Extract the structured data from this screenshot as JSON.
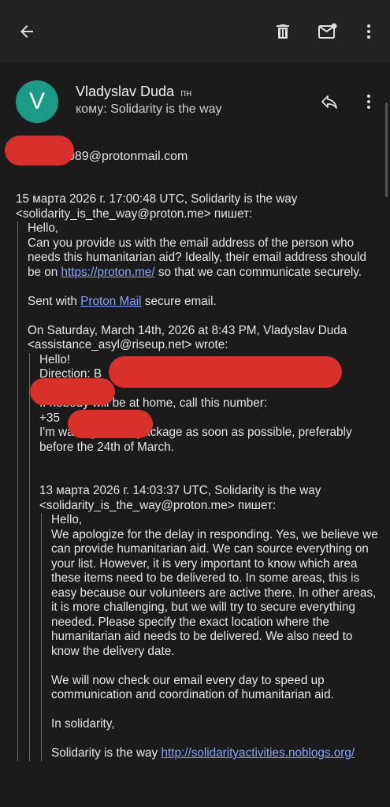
{
  "toolbar": {
    "back_icon": "arrow-back-icon",
    "delete_icon": "trash-icon",
    "mark_unread_icon": "mail-unread-icon",
    "more_icon": "more-vert-icon"
  },
  "header": {
    "avatar_letter": "V",
    "sender_name": "Vladyslav Duda",
    "day": "пн",
    "to_line": "кому: Solidarity is the way",
    "reply_icon": "reply-icon",
    "more_icon": "more-vert-icon"
  },
  "recipient_email_suffix": "089@protonmail.com",
  "message": {
    "intro_line1": "15 марта 2026 г. 17:00:48 UTC, Solidarity is the way",
    "intro_line2": "<solidarity_is_the_way@proton.me> пишет:",
    "q1": {
      "hello": "Hello,",
      "para1_a": "Can you provide us with the email address of the person who needs this humanitarian aid? Ideally, their email address should be on ",
      "para1_link": "https://proton.me/",
      "para1_b": " so that we can communicate securely.",
      "sent_a": "Sent with ",
      "sent_link": "Proton Mail",
      "sent_b": " secure email.",
      "on_line1": "On Saturday, March 14th, 2026 at 8:43 PM, Vladyslav Duda",
      "on_line2": "<assistance_asyl@riseup.net> wrote:",
      "q2": {
        "hello": "Hello!",
        "direction": "Direction: B",
        "if_nobody": "If nobody will be at home, call this number:",
        "phone_prefix": "+35",
        "waiting": "I'm waiting for the package as soon as possible, preferably before the 24th of March.",
        "intro_line1": "13 марта 2026 г. 14:03:37 UTC, Solidarity is the way",
        "intro_line2": "<solidarity_is_the_way@proton.me> пишет:",
        "q3": {
          "hello": "Hello,",
          "para1": "We apologize for the delay in responding. Yes, we believe we can provide humanitarian aid. We can source everything on your list. However, it is very important to know which area these items need to be delivered to. In some areas, this is easy because our volunteers are active there. In other areas, it is more challenging, but we will try to secure everything needed. Please specify the exact location where the humanitarian aid needs to be delivered. We also need to know the delivery date.",
          "para2": "We will now check our email every day to speed up communication and coordination of humanitarian aid.",
          "closing": "In solidarity,",
          "sig_a": "Solidarity is the way ",
          "sig_link": "http://solidarityactivities.noblogs.org/"
        }
      }
    }
  },
  "colors": {
    "background": "#1b1b1b",
    "appbar": "#232323",
    "avatar": "#1b9b86",
    "link": "#8aa4ff",
    "redaction": "#d9302c"
  }
}
